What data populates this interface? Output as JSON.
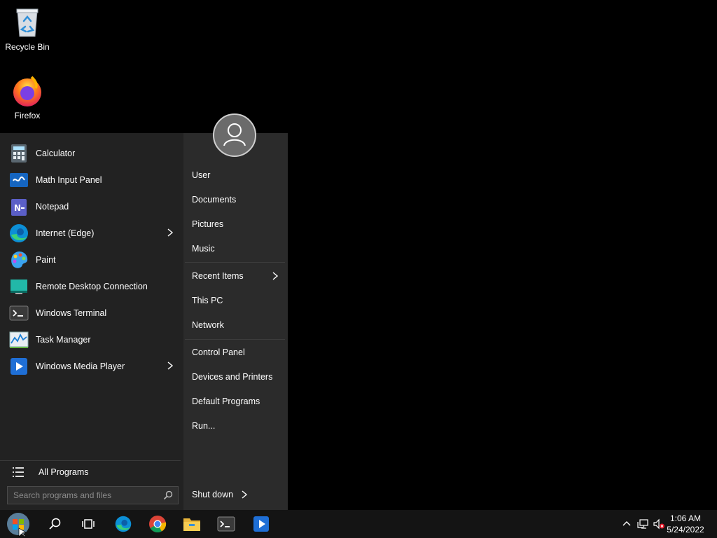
{
  "desktop": {
    "icons": [
      {
        "label": "Recycle Bin",
        "icon": "recycle-bin-icon"
      },
      {
        "label": "Firefox",
        "icon": "firefox-icon"
      }
    ]
  },
  "start_menu": {
    "apps": [
      {
        "label": "Calculator",
        "icon": "calculator-icon",
        "submenu": false
      },
      {
        "label": "Math Input Panel",
        "icon": "math-input-icon",
        "submenu": false
      },
      {
        "label": "Notepad",
        "icon": "notepad-icon",
        "submenu": false
      },
      {
        "label": "Internet (Edge)",
        "icon": "edge-icon",
        "submenu": true
      },
      {
        "label": "Paint",
        "icon": "paint-icon",
        "submenu": false
      },
      {
        "label": "Remote Desktop Connection",
        "icon": "remote-desktop-icon",
        "submenu": false
      },
      {
        "label": "Windows Terminal",
        "icon": "terminal-icon",
        "submenu": false
      },
      {
        "label": "Task Manager",
        "icon": "task-manager-icon",
        "submenu": false
      },
      {
        "label": "Windows Media Player",
        "icon": "media-player-icon",
        "submenu": true
      }
    ],
    "all_programs": "All Programs",
    "search_placeholder": "Search programs and files",
    "right_links": [
      {
        "label": "User"
      },
      {
        "label": "Documents"
      },
      {
        "label": "Pictures"
      },
      {
        "label": "Music"
      },
      {
        "label": "Recent Items",
        "submenu": true
      },
      {
        "label": "This PC"
      },
      {
        "label": "Network"
      },
      {
        "label": "Control Panel"
      },
      {
        "label": "Devices and Printers"
      },
      {
        "label": "Default Programs"
      },
      {
        "label": "Run..."
      }
    ],
    "shutdown": "Shut down"
  },
  "taskbar": {
    "pinned": [
      "start-orb-icon",
      "search-icon",
      "task-view-icon",
      "edge-icon",
      "chrome-icon",
      "file-explorer-icon",
      "terminal-icon",
      "media-player-icon"
    ],
    "tray_icons": [
      "chevron-up-icon",
      "network-icon",
      "volume-muted-icon"
    ],
    "time": "1:06 AM",
    "date": "5/24/2022"
  },
  "colors": {
    "desktop_bg": "#000000",
    "menu_left": "#222222",
    "menu_right": "#2b2b2b",
    "taskbar": "#141414"
  }
}
